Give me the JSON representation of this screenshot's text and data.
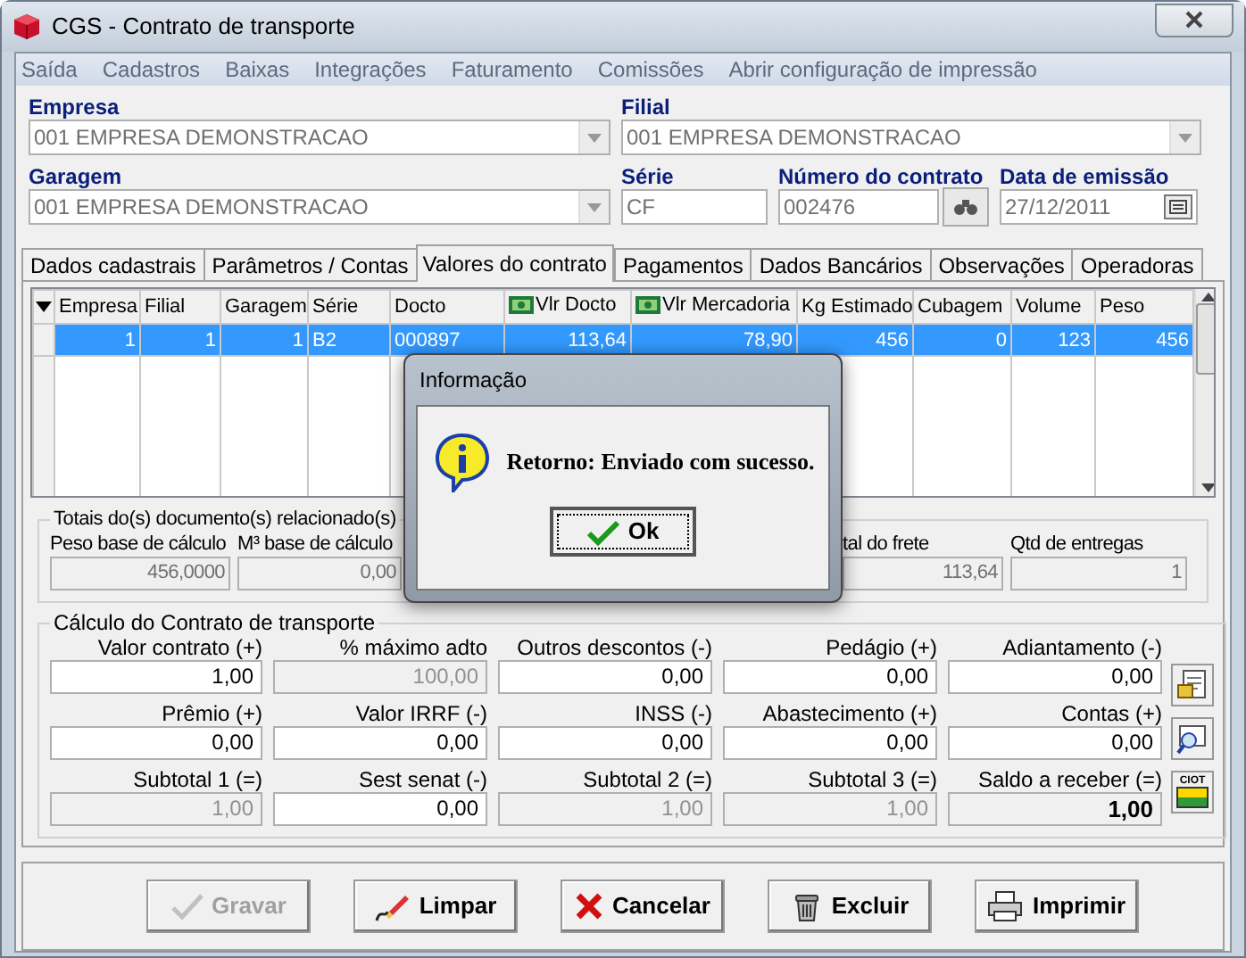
{
  "window": {
    "title": "CGS - Contrato de transporte"
  },
  "menu": [
    "Saída",
    "Cadastros",
    "Baixas",
    "Integrações",
    "Faturamento",
    "Comissões",
    "Abrir configuração de impressão"
  ],
  "header_fields": [
    {
      "label": "Empresa",
      "value": "001 EMPRESA DEMONSTRACAO",
      "kind": "combo"
    },
    {
      "label": "Filial",
      "value": "001 EMPRESA DEMONSTRACAO",
      "kind": "combo"
    },
    {
      "label": "Garagem",
      "value": "001 EMPRESA DEMONSTRACAO",
      "kind": "combo"
    },
    {
      "label": "Série",
      "value": "CF",
      "kind": "text"
    },
    {
      "label": "Número do contrato",
      "value": "002476",
      "kind": "lookup"
    },
    {
      "label": "Data de emissão",
      "value": "27/12/2011",
      "kind": "date"
    }
  ],
  "tabs": [
    {
      "label": "Dados cadastrais",
      "selected": false
    },
    {
      "label": "Parâmetros / Contas",
      "selected": false
    },
    {
      "label": "Valores do contrato",
      "selected": true
    },
    {
      "label": "Pagamentos",
      "selected": false
    },
    {
      "label": "Dados Bancários",
      "selected": false
    },
    {
      "label": "Observações",
      "selected": false
    },
    {
      "label": "Operadoras",
      "selected": false
    }
  ],
  "grid": {
    "columns": [
      {
        "label": "Empresa",
        "kind": "text"
      },
      {
        "label": "Filial",
        "kind": "text"
      },
      {
        "label": "Garagem",
        "kind": "text"
      },
      {
        "label": "Série",
        "kind": "text"
      },
      {
        "label": "Docto",
        "kind": "text"
      },
      {
        "label": "Vlr Docto",
        "kind": "money"
      },
      {
        "label": "Vlr Mercadoria",
        "kind": "money"
      },
      {
        "label": "Kg Estimado",
        "kind": "text"
      },
      {
        "label": "Cubagem",
        "kind": "text"
      },
      {
        "label": "Volume",
        "kind": "text"
      },
      {
        "label": "Peso",
        "kind": "text"
      }
    ],
    "rows": [
      {
        "selected": true,
        "cells": [
          "1",
          "1",
          "1",
          "B2",
          "000897",
          "113,64",
          "78,90",
          "456",
          "0",
          "123",
          "456"
        ]
      }
    ]
  },
  "totals": {
    "title": "Totais do(s) documento(s) relacionado(s)",
    "fields": [
      {
        "label": "Peso base de cálculo",
        "value": "456,0000"
      },
      {
        "label": "M³ base de cálculo",
        "value": "0,00"
      },
      {
        "label": "tal do frete",
        "value": "113,64"
      },
      {
        "label": "Qtd de entregas",
        "value": "1"
      }
    ]
  },
  "calculation": {
    "title": "Cálculo do Contrato de transporte",
    "fields": [
      {
        "label": "Valor contrato (+)",
        "value": "1,00",
        "kind": "input"
      },
      {
        "label": "% máximo adto",
        "value": "100,00",
        "kind": "readonly"
      },
      {
        "label": "Outros descontos (-)",
        "value": "0,00",
        "kind": "input"
      },
      {
        "label": "Pedágio (+)",
        "value": "0,00",
        "kind": "input"
      },
      {
        "label": "Adiantamento (-)",
        "value": "0,00",
        "kind": "input"
      },
      {
        "label": "Prêmio (+)",
        "value": "0,00",
        "kind": "input"
      },
      {
        "label": "Valor IRRF (-)",
        "value": "0,00",
        "kind": "input"
      },
      {
        "label": "INSS (-)",
        "value": "0,00",
        "kind": "input"
      },
      {
        "label": "Abastecimento (+)",
        "value": "0,00",
        "kind": "input"
      },
      {
        "label": "Contas (+)",
        "value": "0,00",
        "kind": "input"
      },
      {
        "label": "Subtotal 1 (=)",
        "value": "1,00",
        "kind": "readonly"
      },
      {
        "label": "Sest senat (-)",
        "value": "0,00",
        "kind": "input"
      },
      {
        "label": "Subtotal 2 (=)",
        "value": "1,00",
        "kind": "readonly"
      },
      {
        "label": "Subtotal 3 (=)",
        "value": "1,00",
        "kind": "readonly"
      },
      {
        "label": "Saldo a receber (=)",
        "value": "1,00",
        "kind": "total"
      }
    ]
  },
  "side_buttons": [
    {
      "kind": "document"
    },
    {
      "kind": "search"
    },
    {
      "kind": "ciot",
      "label": "CIOT"
    }
  ],
  "buttons": [
    {
      "label": "Gravar",
      "kind": "check",
      "disabled": true
    },
    {
      "label": "Limpar",
      "kind": "eraser",
      "disabled": false
    },
    {
      "label": "Cancelar",
      "kind": "cross",
      "disabled": false
    },
    {
      "label": "Excluir",
      "kind": "trash",
      "disabled": false
    },
    {
      "label": "Imprimir",
      "kind": "printer",
      "disabled": false
    }
  ],
  "dialog": {
    "title": "Informação",
    "message": "Retorno: Enviado com sucesso.",
    "button": "Ok"
  }
}
